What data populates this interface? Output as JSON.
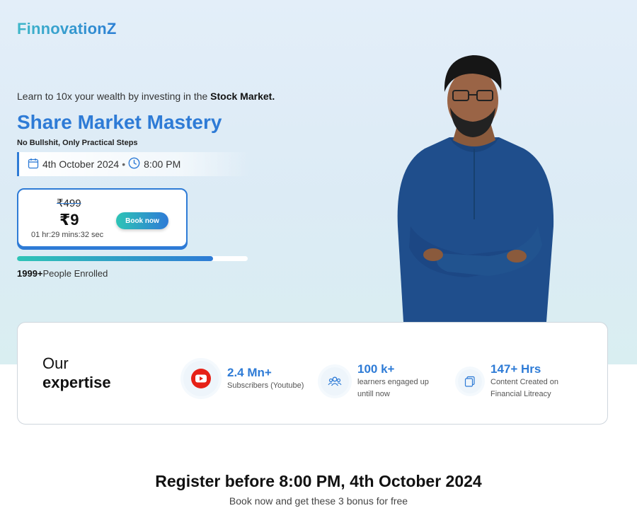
{
  "brand": {
    "logo_text": "FinnovationZ"
  },
  "hero": {
    "tagline_prefix": "Learn to 10x your wealth by investing in the ",
    "tagline_bold": "Stock Market.",
    "title": "Share Market Mastery",
    "subtitle": "No Bullshit, Only Practical Steps",
    "date": "4th October 2024",
    "date_separator": "•",
    "time": "8:00 PM"
  },
  "pricing": {
    "old_price": "₹499",
    "new_price": "₹9",
    "countdown": "01 hr:29 mins:32 sec",
    "book_label": "Book now"
  },
  "enrollment": {
    "progress_fraction": 0.85,
    "count": "1999+",
    "label": "People Enrolled"
  },
  "expertise": {
    "title_line1": "Our",
    "title_line2": "expertise",
    "stats": [
      {
        "value": "2.4 Mn+",
        "desc": "Subscribers (Youtube)",
        "icon": "youtube-icon"
      },
      {
        "value": "100 k+",
        "desc": "learners engaged up untill now",
        "icon": "users-icon"
      },
      {
        "value": "147+ Hrs",
        "desc": "Content Created on Financial Litreacy",
        "icon": "content-icon"
      }
    ]
  },
  "register": {
    "title": "Register before 8:00 PM, 4th October 2024",
    "subtitle": "Book now and get these 3 bonus for free"
  },
  "colors": {
    "accent": "#2e7bd6",
    "teal": "#2ec4b6",
    "youtube_red": "#e62117",
    "shirt": "#1f4e8c"
  }
}
